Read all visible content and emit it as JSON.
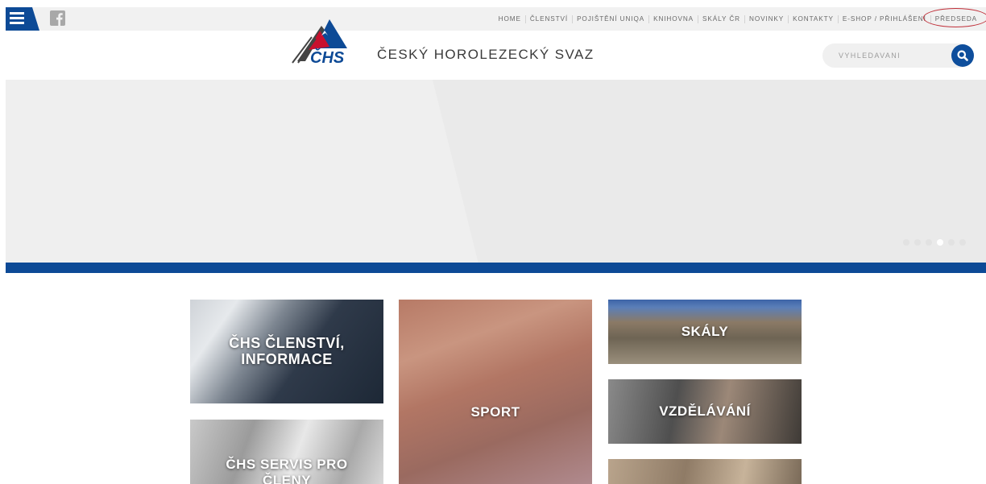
{
  "top_nav": {
    "items": [
      "HOME",
      "ČLENSTVÍ",
      "POJIŠTĚNÍ UNIQA",
      "KNIHOVNA",
      "SKÁLY ČR",
      "NOVINKY",
      "KONTAKTY",
      "E-SHOP / PŘIHLÁŠENÍ",
      "PŘEDSEDA"
    ],
    "highlight_color": "#c0303a"
  },
  "header": {
    "logo_text": "ČHS",
    "title": "ČESKÝ HOROLEZECKÝ SVAZ"
  },
  "search": {
    "placeholder": "VYHLEDAVANI"
  },
  "slider": {
    "dot_count": 6,
    "active_index": 3
  },
  "tiles": {
    "membership": {
      "line1": "ČHS ČLENSTVÍ,",
      "line2": "INFORMACE"
    },
    "servis": {
      "line1": "ČHS SERVIS PRO",
      "line2": "ČLENY"
    },
    "sport": "SPORT",
    "skaly": "SKÁLY",
    "vzdelavani": "VZDĚLÁVÁNÍ"
  },
  "colors": {
    "brand_blue": "#0d4a96",
    "accent_red": "#c8102e"
  }
}
